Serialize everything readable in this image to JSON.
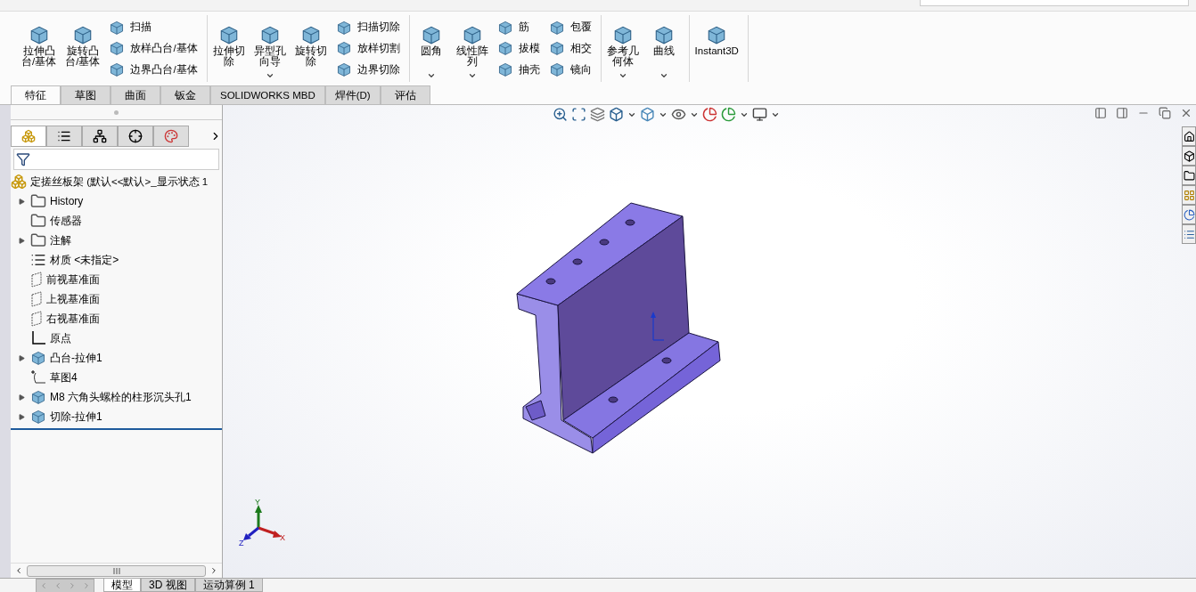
{
  "ribbon": {
    "groups": [
      {
        "columns": [
          {
            "kind": "large",
            "lines": [
              "拉伸凸",
              "台/基体"
            ],
            "dropdown": false
          },
          {
            "kind": "large",
            "lines": [
              "旋转凸",
              "台/基体"
            ],
            "dropdown": false
          },
          {
            "kind": "stack",
            "items": [
              {
                "label": "扫描"
              },
              {
                "label": "放样凸台/基体"
              },
              {
                "label": "边界凸台/基体"
              }
            ]
          }
        ]
      },
      {
        "columns": [
          {
            "kind": "large",
            "lines": [
              "拉伸切",
              "除"
            ],
            "dropdown": false
          },
          {
            "kind": "large",
            "lines": [
              "异型孔",
              "向导"
            ],
            "dropdown": true
          },
          {
            "kind": "large",
            "lines": [
              "旋转切",
              "除"
            ],
            "dropdown": false
          },
          {
            "kind": "stack",
            "items": [
              {
                "label": "扫描切除"
              },
              {
                "label": "放样切割"
              },
              {
                "label": "边界切除"
              }
            ]
          }
        ]
      },
      {
        "columns": [
          {
            "kind": "large",
            "lines": [
              "圆角"
            ],
            "dropdown": true
          },
          {
            "kind": "large",
            "lines": [
              "线性阵",
              "列"
            ],
            "dropdown": true
          },
          {
            "kind": "stack",
            "items": [
              {
                "label": "筋"
              },
              {
                "label": "拔模"
              },
              {
                "label": "抽壳"
              }
            ]
          },
          {
            "kind": "stack",
            "items": [
              {
                "label": "包覆"
              },
              {
                "label": "相交"
              },
              {
                "label": "镜向"
              }
            ]
          }
        ]
      },
      {
        "columns": [
          {
            "kind": "large",
            "lines": [
              "参考几",
              "何体"
            ],
            "dropdown": true
          },
          {
            "kind": "large",
            "lines": [
              "曲线"
            ],
            "dropdown": true
          }
        ]
      },
      {
        "columns": [
          {
            "kind": "large",
            "lines": [
              "Instant3D"
            ],
            "dropdown": false
          }
        ]
      }
    ]
  },
  "ribbon_tabs": [
    {
      "label": "特征",
      "selected": true
    },
    {
      "label": "草图",
      "selected": false
    },
    {
      "label": "曲面",
      "selected": false
    },
    {
      "label": "钣金",
      "selected": false
    },
    {
      "label": "SOLIDWORKS MBD",
      "selected": false
    },
    {
      "label": "焊件(D)",
      "selected": false
    },
    {
      "label": "评估",
      "selected": false
    }
  ],
  "feature_manager": {
    "root": "定搓丝板架  (默认<<默认>_显示状态 1",
    "items": [
      {
        "label": "History",
        "kind": "folder",
        "expander": true
      },
      {
        "label": "传感器",
        "kind": "folder",
        "expander": false
      },
      {
        "label": "注解",
        "kind": "folder",
        "expander": true
      },
      {
        "label": "材质 <未指定>",
        "kind": "material",
        "expander": false
      },
      {
        "label": "前视基准面",
        "kind": "plane",
        "expander": false
      },
      {
        "label": "上视基准面",
        "kind": "plane",
        "expander": false
      },
      {
        "label": "右视基准面",
        "kind": "plane",
        "expander": false
      },
      {
        "label": "原点",
        "kind": "origin",
        "expander": false
      },
      {
        "label": "凸台-拉伸1",
        "kind": "feature",
        "expander": true
      },
      {
        "label": "草图4",
        "kind": "sketch",
        "expander": false
      },
      {
        "label": "M8 六角头螺栓的柱形沉头孔1",
        "kind": "feature",
        "expander": true
      },
      {
        "label": "切除-拉伸1",
        "kind": "feature",
        "expander": true
      }
    ]
  },
  "triad": {
    "x": "X",
    "y": "Y",
    "z": "Z"
  },
  "bottom_tabs": [
    {
      "label": "模型",
      "selected": true
    },
    {
      "label": "3D 视图",
      "selected": false
    },
    {
      "label": "运动算例 1",
      "selected": false
    }
  ]
}
